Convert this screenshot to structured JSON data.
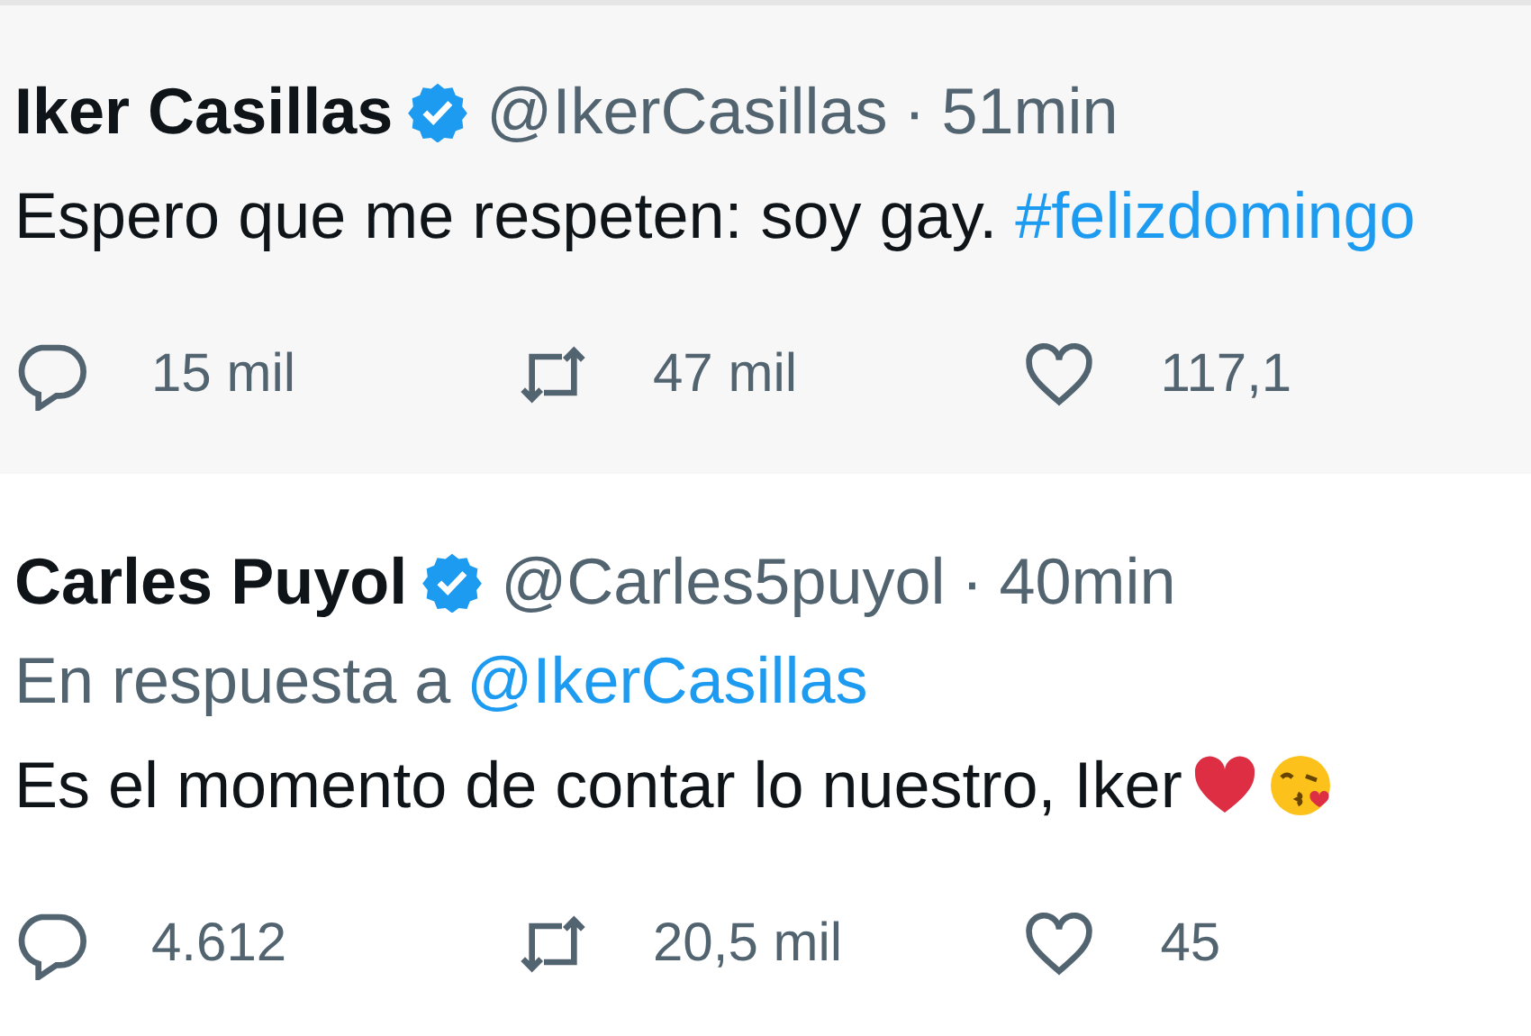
{
  "tweets": [
    {
      "name": "Iker Casillas",
      "handle": "@IkerCasillas",
      "separator": "·",
      "time": "51min",
      "verified": true,
      "highlighted": true,
      "text": "Espero que me respeten: soy gay. ",
      "hashtag": "#felizdomingo",
      "replies": "15 mil",
      "retweets": "47 mil",
      "likes": "117,1"
    },
    {
      "name": "Carles Puyol",
      "handle": "@Carles5puyol",
      "separator": "·",
      "time": "40min",
      "verified": true,
      "highlighted": false,
      "reply_label": "En respuesta a",
      "reply_to": "@IkerCasillas",
      "text": "Es el momento de contar lo nuestro, Iker",
      "emoji": [
        {
          "kind": "heart"
        },
        {
          "kind": "kiss"
        }
      ],
      "replies": "4.612",
      "retweets": "20,5 mil",
      "likes": "45"
    }
  ]
}
